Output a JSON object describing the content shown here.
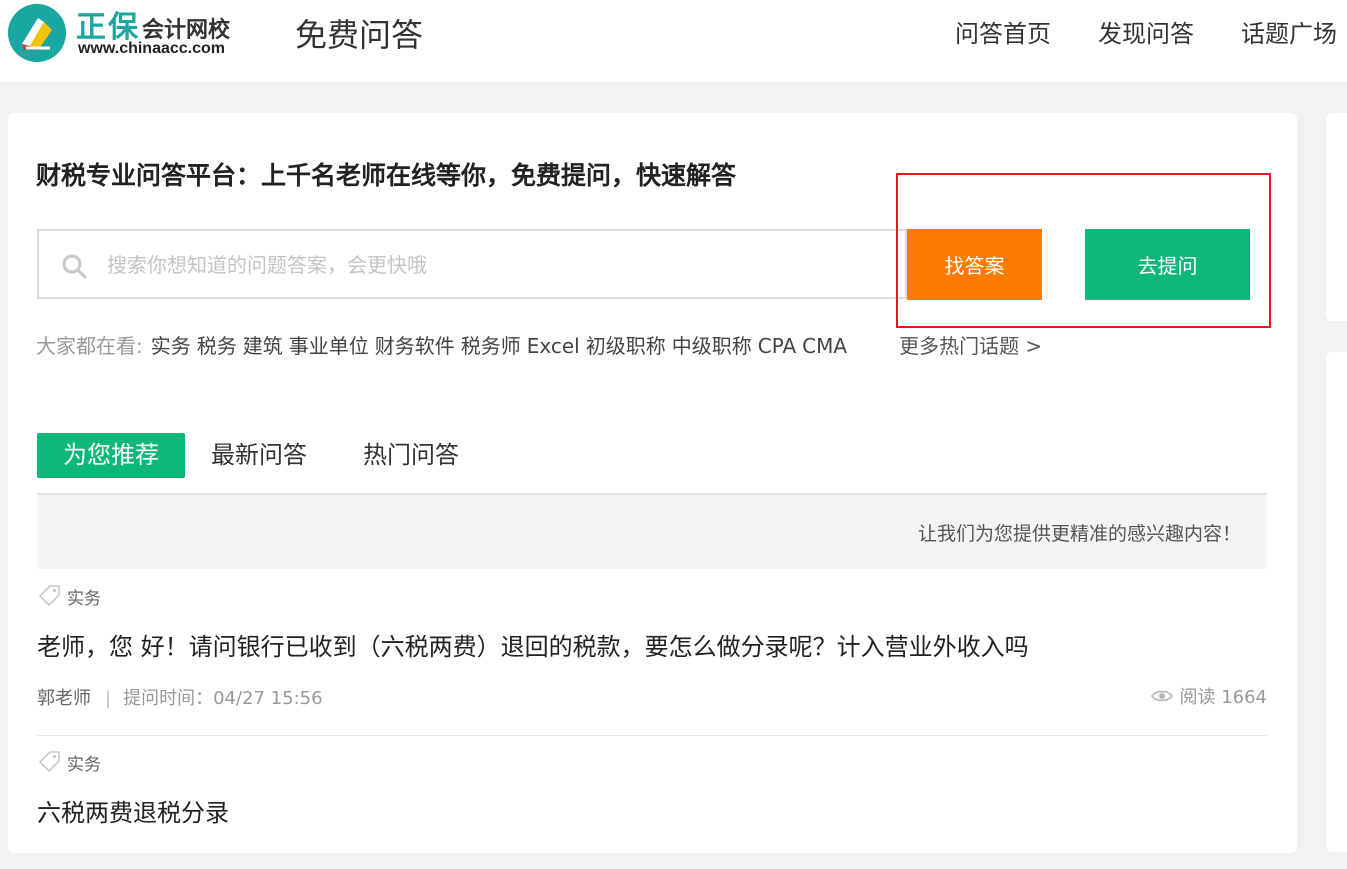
{
  "header": {
    "logo_cn_big": "正保",
    "logo_cn_small": "会计网校",
    "logo_url": "www.chinaacc.com",
    "title": "免费问答",
    "nav": [
      "问答首页",
      "发现问答",
      "话题广场"
    ]
  },
  "main": {
    "slogan": "财税专业问答平台：上千名老师在线等你，免费提问，快速解答",
    "search": {
      "placeholder": "搜索你想知道的问题答案，会更快哦",
      "value": ""
    },
    "find_button": "找答案",
    "ask_button": "去提问",
    "hot": {
      "label": "大家都在看:",
      "tags": [
        "实务",
        "税务",
        "建筑",
        "事业单位",
        "财务软件",
        "税务师",
        "Excel",
        "初级职称",
        "中级职称",
        "CPA",
        "CMA"
      ],
      "more": "更多热门话题 >"
    },
    "tabs": [
      "为您推荐",
      "最新问答",
      "热门问答"
    ],
    "active_tab": "为您推荐",
    "notice": "让我们为您提供更精准的感兴趣内容！",
    "questions": [
      {
        "tag": "实务",
        "title": "老师，您 好！请问银行已收到（六税两费）退回的税款，要怎么做分录呢？计入营业外收入吗",
        "author": "郭老师",
        "time": "提问时间：04/27 15:56",
        "read": "阅读 1664"
      },
      {
        "tag": "实务",
        "title": "六税两费退税分录"
      }
    ]
  },
  "colors": {
    "brand_teal": "#1ba7a1",
    "find_orange": "#ff7a00",
    "ask_green": "#0cb77a",
    "highlight_red": "#e8141b"
  }
}
